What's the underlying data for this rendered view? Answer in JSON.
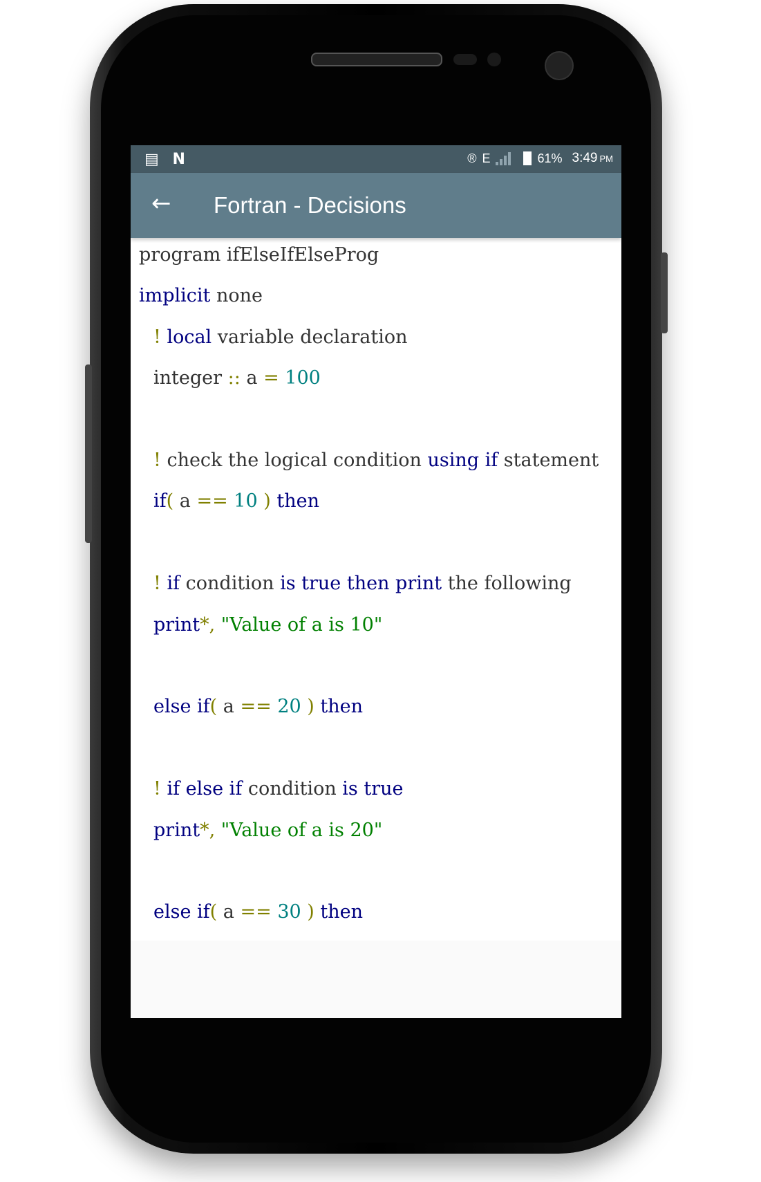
{
  "status_bar": {
    "left_icons": [
      "notes-icon",
      "n-icon"
    ],
    "right_icons": [
      "registered-icon",
      "network-e-icon",
      "signal-icon",
      "battery-charging-icon"
    ],
    "network": "E",
    "battery": "61%",
    "time": "3:49",
    "ampm": "PM"
  },
  "app_bar": {
    "back_icon": "arrow-left-icon",
    "title": "Fortran - Decisions"
  },
  "colors": {
    "status_bar": "#455a64",
    "app_bar": "#607d8b",
    "keyword": "#000080",
    "comment_mark": "#808000",
    "number": "#008080",
    "string": "#008000",
    "text": "#333333"
  },
  "code_lines": [
    {
      "indent": 0,
      "tokens": [
        {
          "t": "program ifElseIfElseProg",
          "c": ""
        }
      ]
    },
    {
      "indent": 0,
      "tokens": [
        {
          "t": "implicit",
          "c": "k"
        },
        {
          "t": " none",
          "c": ""
        }
      ]
    },
    {
      "indent": 1,
      "tokens": [
        {
          "t": "!",
          "c": "c"
        },
        {
          "t": " local",
          "c": "k"
        },
        {
          "t": " variable declaration",
          "c": ""
        }
      ]
    },
    {
      "indent": 1,
      "tokens": [
        {
          "t": "integer",
          "c": ""
        },
        {
          "t": " ::",
          "c": "o"
        },
        {
          "t": " a ",
          "c": ""
        },
        {
          "t": "=",
          "c": "o"
        },
        {
          "t": " 100",
          "c": "n"
        }
      ]
    },
    {
      "indent": 1,
      "tokens": []
    },
    {
      "indent": 1,
      "tokens": [
        {
          "t": "!",
          "c": "c"
        },
        {
          "t": " check the logical condition ",
          "c": ""
        },
        {
          "t": "using if",
          "c": "k"
        },
        {
          "t": " statement",
          "c": ""
        }
      ]
    },
    {
      "indent": 1,
      "tokens": [
        {
          "t": "if",
          "c": "k"
        },
        {
          "t": "(",
          "c": "o"
        },
        {
          "t": " a ",
          "c": ""
        },
        {
          "t": "==",
          "c": "o"
        },
        {
          "t": " 10",
          "c": "n"
        },
        {
          "t": " )",
          "c": "o"
        },
        {
          "t": " then",
          "c": "k"
        }
      ]
    },
    {
      "indent": 1,
      "tokens": []
    },
    {
      "indent": 1,
      "tokens": [
        {
          "t": "!",
          "c": "c"
        },
        {
          "t": " if",
          "c": "k"
        },
        {
          "t": " condition ",
          "c": ""
        },
        {
          "t": "is true then print",
          "c": "k"
        },
        {
          "t": " the following",
          "c": ""
        }
      ]
    },
    {
      "indent": 1,
      "tokens": [
        {
          "t": "print",
          "c": "k"
        },
        {
          "t": "*,",
          "c": "o"
        },
        {
          "t": " \"Value of a is 10\"",
          "c": "s"
        }
      ]
    },
    {
      "indent": 1,
      "tokens": []
    },
    {
      "indent": 1,
      "tokens": [
        {
          "t": "else if",
          "c": "k"
        },
        {
          "t": "(",
          "c": "o"
        },
        {
          "t": " a ",
          "c": ""
        },
        {
          "t": "==",
          "c": "o"
        },
        {
          "t": " 20",
          "c": "n"
        },
        {
          "t": " )",
          "c": "o"
        },
        {
          "t": " then",
          "c": "k"
        }
      ]
    },
    {
      "indent": 1,
      "tokens": []
    },
    {
      "indent": 1,
      "tokens": [
        {
          "t": "!",
          "c": "c"
        },
        {
          "t": " if else if",
          "c": "k"
        },
        {
          "t": " condition ",
          "c": ""
        },
        {
          "t": "is true",
          "c": "k"
        }
      ]
    },
    {
      "indent": 1,
      "tokens": [
        {
          "t": "print",
          "c": "k"
        },
        {
          "t": "*,",
          "c": "o"
        },
        {
          "t": " \"Value of a is 20\"",
          "c": "s"
        }
      ]
    },
    {
      "indent": 1,
      "tokens": []
    },
    {
      "indent": 1,
      "tokens": [
        {
          "t": "else if",
          "c": "k"
        },
        {
          "t": "(",
          "c": "o"
        },
        {
          "t": " a ",
          "c": ""
        },
        {
          "t": "==",
          "c": "o"
        },
        {
          "t": " 30",
          "c": "n"
        },
        {
          "t": " )",
          "c": "o"
        },
        {
          "t": " then",
          "c": "k"
        }
      ]
    }
  ]
}
